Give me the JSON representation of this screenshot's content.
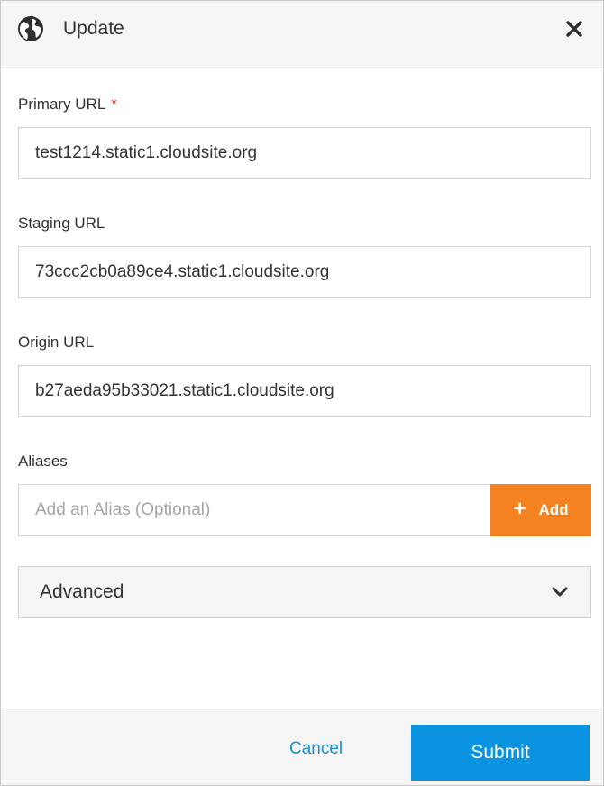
{
  "dialog": {
    "title": "Update",
    "icon": "globe-icon",
    "close_icon": "close-icon"
  },
  "form": {
    "primary_url": {
      "label": "Primary URL",
      "required_marker": "*",
      "value": "test1214.static1.cloudsite.org"
    },
    "staging_url": {
      "label": "Staging URL",
      "value": "73ccc2cb0a89ce4.static1.cloudsite.org"
    },
    "origin_url": {
      "label": "Origin URL",
      "value": "b27aeda95b33021.static1.cloudsite.org"
    },
    "aliases": {
      "label": "Aliases",
      "placeholder": "Add an Alias (Optional)",
      "value": "",
      "add_label": "Add",
      "add_icon": "plus-icon"
    },
    "advanced": {
      "label": "Advanced",
      "icon": "chevron-down-icon",
      "expanded": false
    }
  },
  "footer": {
    "cancel_label": "Cancel",
    "submit_label": "Submit"
  },
  "colors": {
    "accent_orange": "#f58220",
    "primary_blue": "#0a93e0",
    "link_blue": "#1a8fd6",
    "required_red": "#d9342b",
    "header_bg": "#f5f5f5"
  }
}
